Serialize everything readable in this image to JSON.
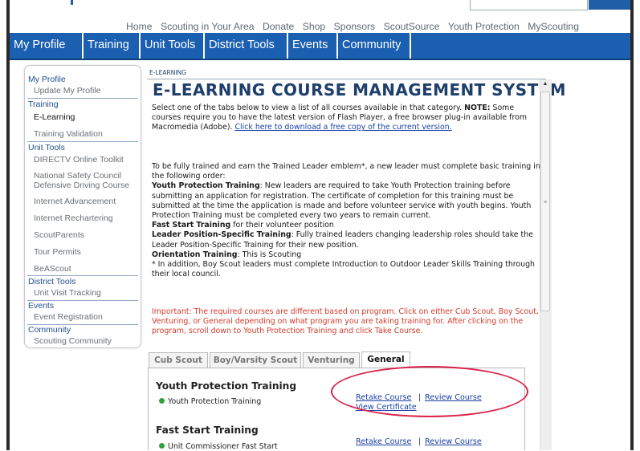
{
  "utility_nav": [
    "Home",
    "Scouting in Your Area",
    "Donate",
    "Shop",
    "Sponsors",
    "ScoutSource",
    "Youth Protection",
    "MyScouting"
  ],
  "main_nav": [
    "My Profile",
    "Training",
    "Unit Tools",
    "District Tools",
    "Events",
    "Community"
  ],
  "sidebar": {
    "my_profile": "My Profile",
    "update_my_profile": "Update My Profile",
    "training": "Training",
    "e_learning": "E-Learning",
    "training_validation": "Training Validation",
    "unit_tools": "Unit Tools",
    "directv": "DIRECTV Online Toolkit",
    "nsc_line1": "National Safety Council",
    "nsc_line2": "Defensive Driving Course",
    "internet_advancement": "Internet Advancement",
    "internet_rechartering": "Internet Rechartering",
    "scoutparents": "ScoutParents",
    "tour_permits": "Tour Permits",
    "beascout": "BeAScout",
    "district_tools": "District Tools",
    "unit_visit_tracking": "Unit Visit Tracking",
    "events": "Events",
    "event_registration": "Event Registration",
    "community": "Community",
    "scouting_community": "Scouting Community"
  },
  "content": {
    "breadcrumb": "E-LEARNING",
    "title": "E-LEARNING COURSE MANAGEMENT SYSTEM",
    "intro_1": "Select one of the tabs below to view a list of all courses available in that category.",
    "intro_note": "NOTE:",
    "intro_2": "Some courses require you to have the latest version of Flash Player, a free browser plug-in available from Macromedia (Adobe).",
    "flash_link": "Click here to download a free copy of the current version.",
    "trained_leader": "To be fully trained and earn the Trained Leader emblem*, a new leader must complete basic training in the following order:",
    "ypt_label": "Youth Protection Training",
    "ypt_text": ": New leaders are required to take Youth Protection training before submitting an application for registration. The certificate of completion for this training must be submitted at the time the application is made and before volunteer service with youth begins. Youth Protection Training must be completed every two years to remain current.",
    "fst_label": "Fast Start Training",
    "fst_text": " for their volunteer position",
    "lps_label": "Leader Position-Specific Training",
    "lps_text": ": Fully trained leaders changing leadership roles should take the Leader Position-Specific Training for their new position.",
    "ot_label": "Orientation Training",
    "ot_text": ": This is Scouting",
    "footnote": "* In addition, Boy Scout leaders must complete Introduction to Outdoor Leader Skills Training through their local council.",
    "important": "Important: The required courses are different based on program. Click on either Cub Scout, Boy Scout, Venturing, or General depending on what program you are taking training for. After clicking on the program, scroll down to Youth Protection Training and click Take Course."
  },
  "program_tabs": [
    "Cub Scout",
    "Boy/Varsity Scout",
    "Venturing",
    "General"
  ],
  "sections": [
    {
      "title": "Youth Protection Training",
      "course": "Youth Protection Training",
      "retake": "Retake Course",
      "review": "Review Course",
      "certificate": "View Certificate"
    },
    {
      "title": "Fast Start Training",
      "course": "Unit Commissioner Fast Start",
      "retake": "Retake Course",
      "review": "Review Course"
    }
  ],
  "separator": "|",
  "colors": {
    "nav_blue": "#1a5fb0",
    "title_blue": "#1f3f6b",
    "link_blue": "#1a3fa6",
    "important_red": "#d63a2a",
    "highlight_red": "#d9234a",
    "complete_green": "#2ea33a"
  }
}
